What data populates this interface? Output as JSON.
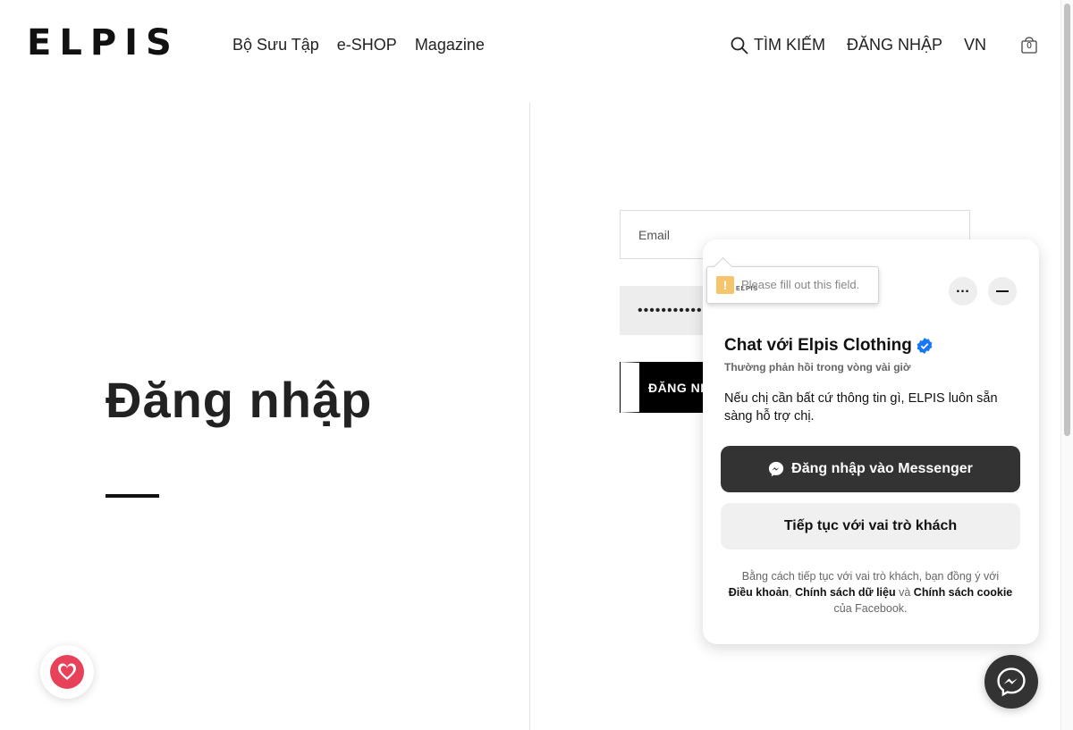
{
  "header": {
    "logo": "ELPIS",
    "nav": [
      "Bộ Sưu Tập",
      "e-SHOP",
      "Magazine"
    ],
    "search_label": "TÌM KIẾM",
    "login_label": "ĐĂNG NHẬP",
    "lang_label": "VN",
    "cart_count": "0"
  },
  "main": {
    "title": "Đăng nhập",
    "email_placeholder": "Email",
    "password_value": "•••••••••••••",
    "login_button": "ĐĂNG NHẬP"
  },
  "validation": {
    "message": "Please fill out this field.",
    "logo": "ELPIS"
  },
  "chat": {
    "title": "Chat với Elpis Clothing",
    "subtitle": "Thường phản hồi trong vòng vài giờ",
    "message": "Nếu chị cần bất cứ thông tin gì, ELPIS luôn sẵn sàng hỗ trợ chị.",
    "messenger_button": "Đăng nhập vào Messenger",
    "guest_button": "Tiếp tục với vai trò khách",
    "legal_prefix": "Bằng cách tiếp tục với vai trò khách, bạn đồng ý với",
    "legal_terms": "Điều khoản",
    "legal_sep": ",",
    "legal_privacy": "Chính sách dữ liệu",
    "legal_and": "và",
    "legal_cookie": "Chính sách cookie",
    "legal_suffix": "của Facebook."
  },
  "colors": {
    "brand_black": "#111111",
    "messenger_dark": "#333333",
    "heart_red": "#e8425a",
    "verified_blue": "#1877f2"
  },
  "icons": [
    "search-icon",
    "cart-icon",
    "more-icon",
    "minimize-icon",
    "verified-icon",
    "messenger-icon",
    "heart-icon",
    "warning-icon"
  ]
}
